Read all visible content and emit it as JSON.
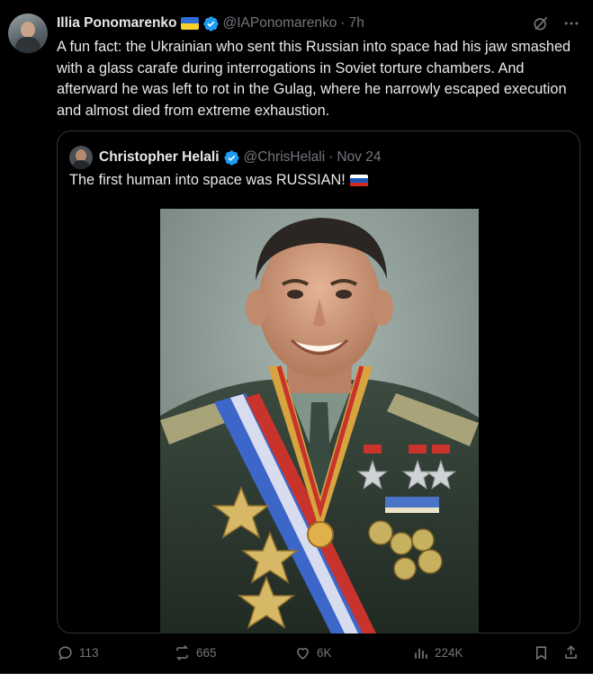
{
  "tweet": {
    "author_name": "Illia Ponomarenko",
    "author_handle": "@IAPonomarenko",
    "separator": "·",
    "time": "7h",
    "text": "A fun fact: the Ukrainian who sent this Russian into space had his jaw smashed with a glass carafe during interrogations in Soviet torture chambers. And afterward he was left to rot in the Gulag, where he narrowly escaped execution and almost died from extreme exhaustion.",
    "icons": {
      "flag": "ukraine-flag-icon",
      "verified": "verified-badge-icon",
      "grok": "grok-icon",
      "more": "more-icon"
    }
  },
  "quote": {
    "author_name": "Christopher Helali",
    "author_handle": "@ChrisHelali",
    "separator": "·",
    "date": "Nov 24",
    "text": "The first human into space was RUSSIAN!",
    "image_alt": "Portrait of a smiling man in military uniform with medals and sashes"
  },
  "actions": {
    "replies": "113",
    "reposts": "665",
    "likes": "6K",
    "views": "224K"
  },
  "colors": {
    "background": "#000000",
    "text": "#e7e9ea",
    "muted": "#71767b",
    "border": "#2f3336",
    "verified": "#1d9bf0"
  }
}
